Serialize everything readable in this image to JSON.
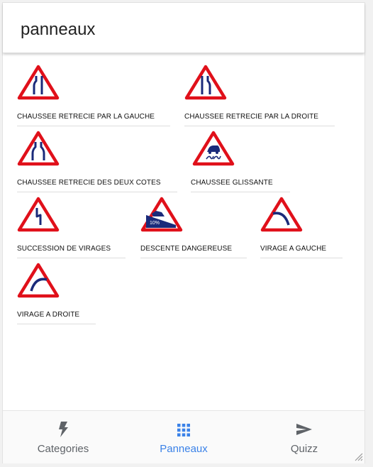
{
  "header": {
    "title": "panneaux"
  },
  "signs": [
    {
      "label": "CHAUSSEE RETRECIE PAR LA GAUCHE",
      "icon": "road-narrows-left-icon"
    },
    {
      "label": "CHAUSSEE RETRECIE PAR LA DROITE",
      "icon": "road-narrows-right-icon"
    },
    {
      "label": "CHAUSSEE RETRECIE DES DEUX COTES",
      "icon": "road-narrows-both-sides-icon"
    },
    {
      "label": "CHAUSSEE GLISSANTE",
      "icon": "slippery-road-icon"
    },
    {
      "label": "SUCCESSION DE VIRAGES",
      "icon": "series-of-bends-icon"
    },
    {
      "label": "DESCENTE DANGEREUSE",
      "icon": "dangerous-descent-icon"
    },
    {
      "label": "VIRAGE A GAUCHE",
      "icon": "bend-left-icon"
    },
    {
      "label": "VIRAGE A DROITE",
      "icon": "bend-right-icon"
    }
  ],
  "tabs": [
    {
      "label": "Categories",
      "icon": "bolt-icon",
      "active": false
    },
    {
      "label": "Panneaux",
      "icon": "grid-icon",
      "active": true
    },
    {
      "label": "Quizz",
      "icon": "send-icon",
      "active": false
    }
  ],
  "colors": {
    "sign_border": "#e0101a",
    "sign_symbol": "#1a2a7a",
    "active_tab": "#3b82e8",
    "inactive_tab": "#5f6368"
  }
}
